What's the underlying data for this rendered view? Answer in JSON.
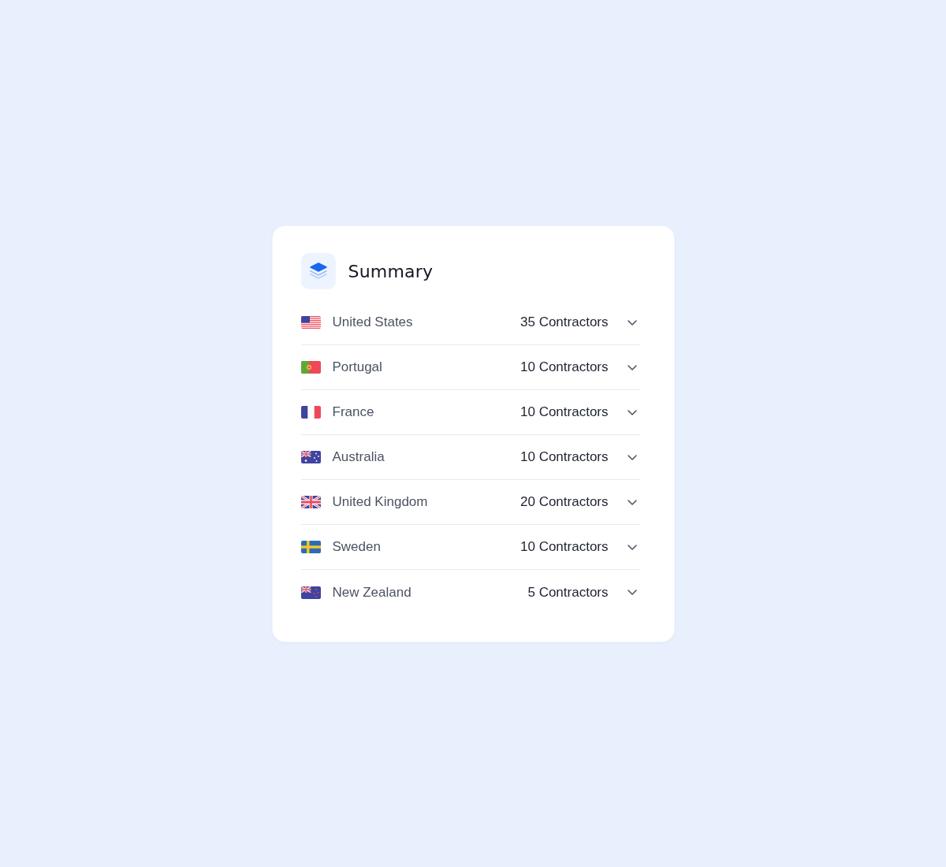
{
  "card": {
    "title": "Summary"
  },
  "rows": [
    {
      "kind": "us",
      "country": "United States",
      "count": "35 Contractors",
      "expanded": false
    },
    {
      "kind": "pt",
      "country": "Portugal",
      "count": "10 Contractors",
      "expanded": false
    },
    {
      "kind": "fr",
      "country": "France",
      "count": "10 Contractors",
      "expanded": false
    },
    {
      "kind": "au",
      "country": "Australia",
      "count": "10 Contractors",
      "expanded": false
    },
    {
      "kind": "uk",
      "country": "United Kingdom",
      "count": "20 Contractors",
      "expanded": false
    },
    {
      "kind": "se",
      "country": "Sweden",
      "count": "10 Contractors",
      "expanded": false
    },
    {
      "kind": "nz",
      "country": "New Zealand",
      "count": "5 Contractors",
      "expanded": false
    }
  ]
}
